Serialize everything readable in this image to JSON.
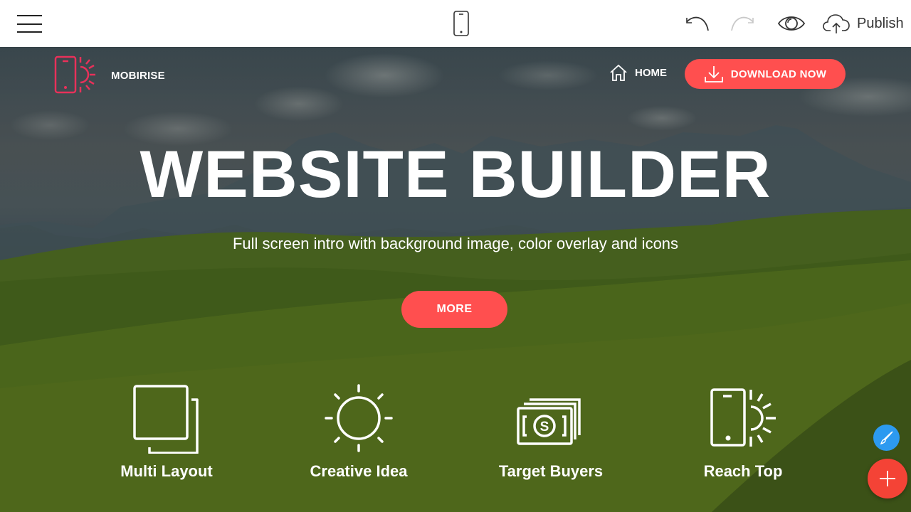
{
  "toolbar": {
    "menu_icon": "hamburger-menu-icon",
    "device_icon": "mobile-phone-icon",
    "undo_icon": "undo-icon",
    "redo_icon": "redo-icon",
    "preview_icon": "eye-icon",
    "publish_icon": "cloud-upload-icon",
    "publish_label": "Publish"
  },
  "site": {
    "brand": {
      "name": "MOBIRISE",
      "logo_icon": "phone-sun-icon",
      "logo_color": "#e8315a"
    },
    "nav": {
      "home_label": "HOME",
      "home_icon": "home-icon",
      "download_label": "DOWNLOAD NOW",
      "download_icon": "download-icon"
    },
    "hero": {
      "title": "WEBSITE BUILDER",
      "subtitle": "Full screen intro with background image, color overlay and icons",
      "button_label": "MORE"
    },
    "features": [
      {
        "title": "Multi Layout",
        "icon": "layers-icon"
      },
      {
        "title": "Creative Idea",
        "icon": "sun-icon"
      },
      {
        "title": "Target Buyers",
        "icon": "money-icon"
      },
      {
        "title": "Reach Top",
        "icon": "phone-sun-icon"
      }
    ]
  },
  "fab": {
    "edit_icon": "paint-brush-icon",
    "add_icon": "plus-icon"
  },
  "colors": {
    "accent": "#ff4f4f",
    "fab_edit": "#2c9af0",
    "fab_add": "#f44336",
    "brand_logo": "#e8315a"
  }
}
